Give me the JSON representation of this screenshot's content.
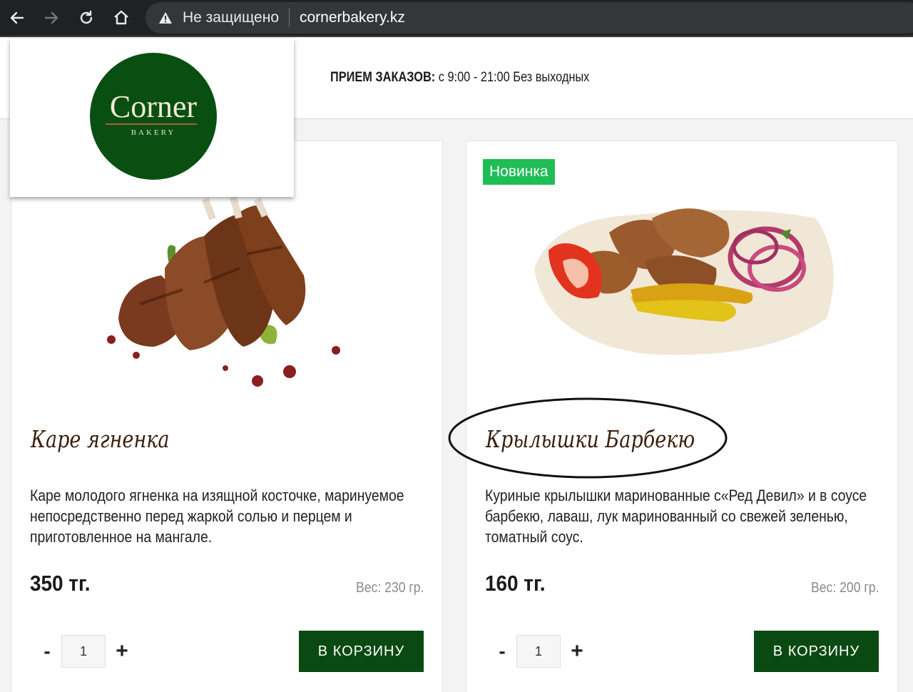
{
  "browser": {
    "security_label": "Не защищено",
    "url": "cornerbakery.kz",
    "icons": [
      "back-arrow-icon",
      "forward-arrow-icon",
      "reload-icon",
      "home-icon",
      "warning-icon"
    ]
  },
  "header": {
    "logo": {
      "word": "Corner",
      "sub": "BAKERY"
    },
    "hours_label": "ПРИЕМ ЗАКАЗОВ:",
    "hours_value": " с 9:00 - 21:00 Без выходных"
  },
  "products": [
    {
      "badge": "",
      "title": "Каре ягненка",
      "description": "Каре молодого ягненка на изящной косточке, маринуемое непосредственно перед жаркой солью и перцем и приготовленное на мангале.",
      "price": "350 тг.",
      "weight": "Вес: 230 гр.",
      "qty": "1",
      "minus": "-",
      "plus": "+",
      "cart_label": "В КОРЗИНУ"
    },
    {
      "badge": "Новинка",
      "title": "Крылышки Барбекю",
      "description": "Куриные крылышки маринованные с«Ред Девил» и в соусе барбекю, лаваш, лук маринованный со свежей зеленью, томатный соус.",
      "price": "160 тг.",
      "weight": "Вес: 200 гр.",
      "qty": "1",
      "minus": "-",
      "plus": "+",
      "cart_label": "В КОРЗИНУ"
    }
  ],
  "colors": {
    "brand_green": "#0a4f12",
    "button_green": "#0a4a12",
    "badge_green": "#1fbd55",
    "title_brown": "#3b1f0e"
  }
}
